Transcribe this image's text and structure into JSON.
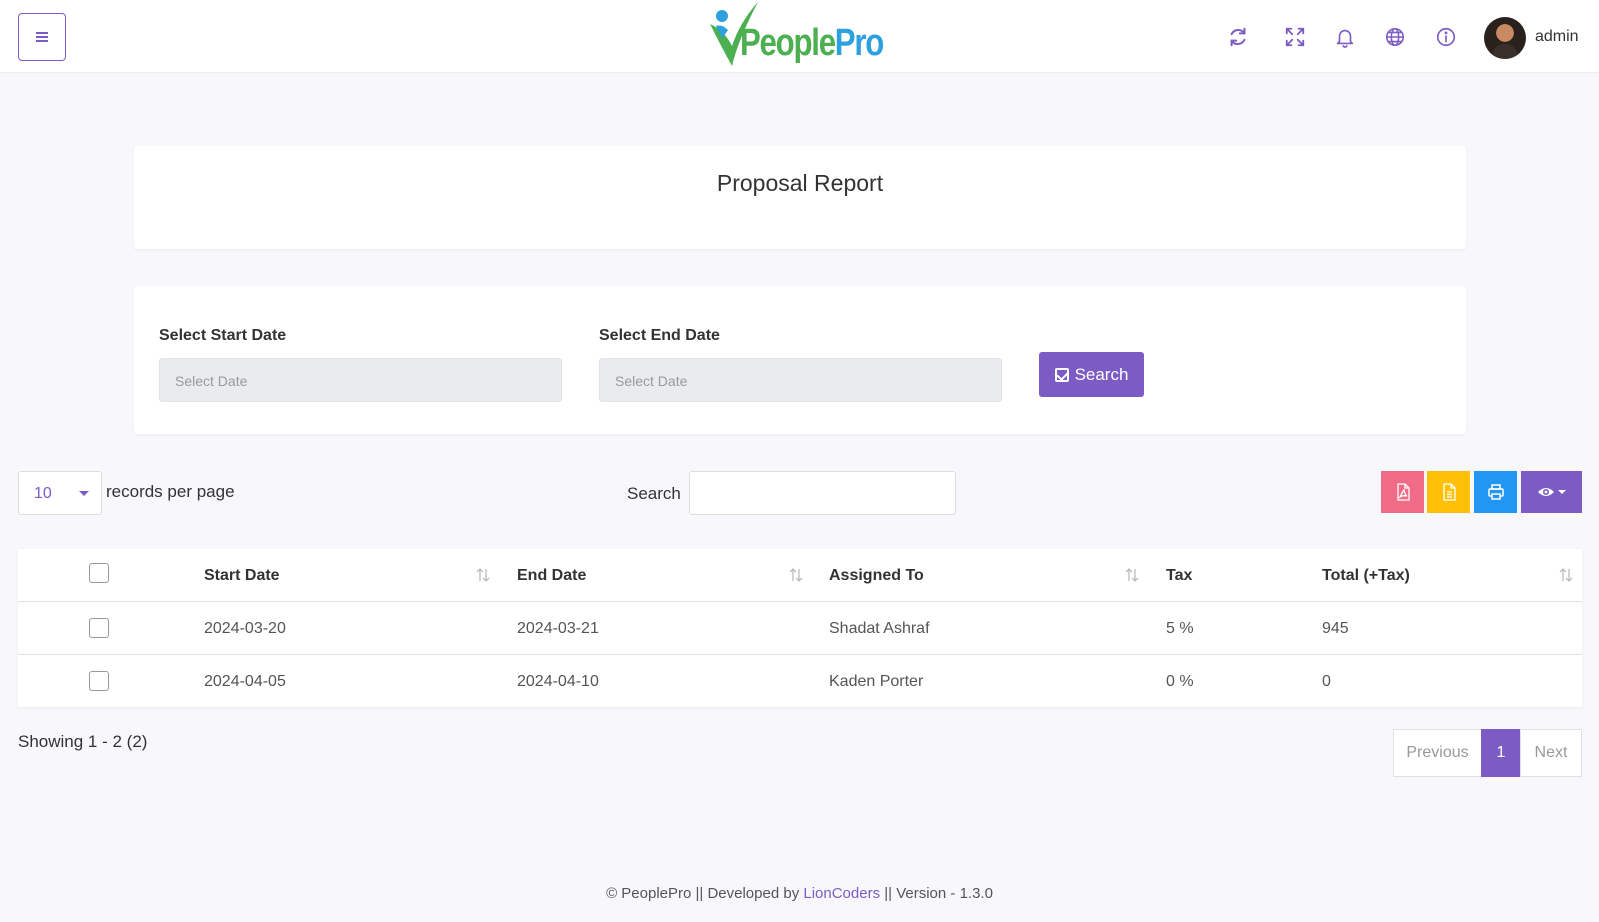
{
  "header": {
    "logo_text_a": "People",
    "logo_text_b": "Pro",
    "username": "admin"
  },
  "page": {
    "title": "Proposal Report"
  },
  "filters": {
    "start_label": "Select Start Date",
    "start_placeholder": "Select Date",
    "end_label": "Select End Date",
    "end_placeholder": "Select Date",
    "search_button": "Search"
  },
  "table_controls": {
    "page_length": "10",
    "page_length_label": "records per page",
    "search_label": "Search"
  },
  "table": {
    "columns": [
      "Start Date",
      "End Date",
      "Assigned To",
      "Tax",
      "Total (+Tax)"
    ],
    "rows": [
      [
        "2024-03-20",
        "2024-03-21",
        "Shadat Ashraf",
        "5 %",
        "945"
      ],
      [
        "2024-04-05",
        "2024-04-10",
        "Kaden Porter",
        "0 %",
        "0"
      ]
    ]
  },
  "pagination": {
    "summary": "Showing 1 - 2 (2)",
    "previous": "Previous",
    "current": "1",
    "next": "Next"
  },
  "footer": {
    "prefix": "© PeoplePro || Developed by ",
    "link": "LionCoders",
    "suffix": " || Version - 1.3.0"
  },
  "colors": {
    "accent": "#7c5cc4",
    "pdf_button": "#f06b85",
    "csv_button": "#ffc107",
    "print_button": "#2196f3",
    "visibility_button": "#7c5cc4"
  }
}
